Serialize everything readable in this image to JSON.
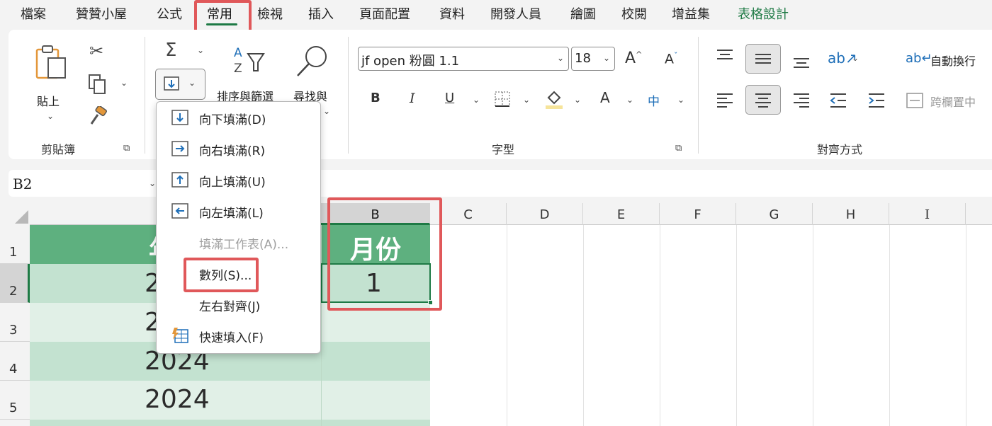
{
  "menubar": {
    "tabs": [
      {
        "label": "檔案"
      },
      {
        "label": "贊贊小屋"
      },
      {
        "label": "公式"
      },
      {
        "label": "常用"
      },
      {
        "label": "檢視"
      },
      {
        "label": "插入"
      },
      {
        "label": "頁面配置"
      },
      {
        "label": "資料"
      },
      {
        "label": "開發人員"
      },
      {
        "label": "繪圖"
      },
      {
        "label": "校閱"
      },
      {
        "label": "增益集"
      },
      {
        "label": "表格設計"
      }
    ],
    "active_tab": "常用"
  },
  "ribbon": {
    "clipboard": {
      "paste_label": "貼上",
      "group_label": "剪貼簿"
    },
    "editing": {
      "sum_symbol": "Σ",
      "sort_filter_label": "排序與篩選",
      "find_label": "尋找與"
    },
    "font": {
      "font_name": "jf open 粉圓 1.1",
      "font_size": "18",
      "bold": "B",
      "italic": "I",
      "underline": "U",
      "font_color_glyph": "A",
      "phonetic_glyph": "中",
      "group_label": "字型"
    },
    "alignment": {
      "wrap_text_label": "自動換行",
      "merge_label": "跨欄置中",
      "group_label": "對齊方式"
    }
  },
  "namebox": {
    "value": "B2"
  },
  "fill_menu": {
    "items": [
      {
        "label": "向下填滿(D)",
        "enabled": true
      },
      {
        "label": "向右填滿(R)",
        "enabled": true
      },
      {
        "label": "向上填滿(U)",
        "enabled": true
      },
      {
        "label": "向左填滿(L)",
        "enabled": true
      },
      {
        "label": "填滿工作表(A)...",
        "enabled": false
      },
      {
        "label": "數列(S)...",
        "enabled": true
      },
      {
        "label": "左右對齊(J)",
        "enabled": true
      },
      {
        "label": "快速填入(F)",
        "enabled": true
      }
    ]
  },
  "sheet": {
    "columns": [
      "B",
      "C",
      "D",
      "E",
      "F",
      "G",
      "H",
      "I"
    ],
    "rows": [
      "1",
      "2",
      "3",
      "4",
      "5"
    ],
    "cells": {
      "A1": "年",
      "A2": "2024",
      "A3": "2024",
      "A4": "2024",
      "A5": "2024",
      "B1": "月份",
      "B2": "1"
    },
    "selected_cell": "B2"
  },
  "colors": {
    "accent_green": "#1e7a45",
    "table_header": "#5eb07f",
    "band_dark": "#c3e2d0",
    "band_light": "#e1f0e7",
    "highlight_red": "#e0585a"
  }
}
